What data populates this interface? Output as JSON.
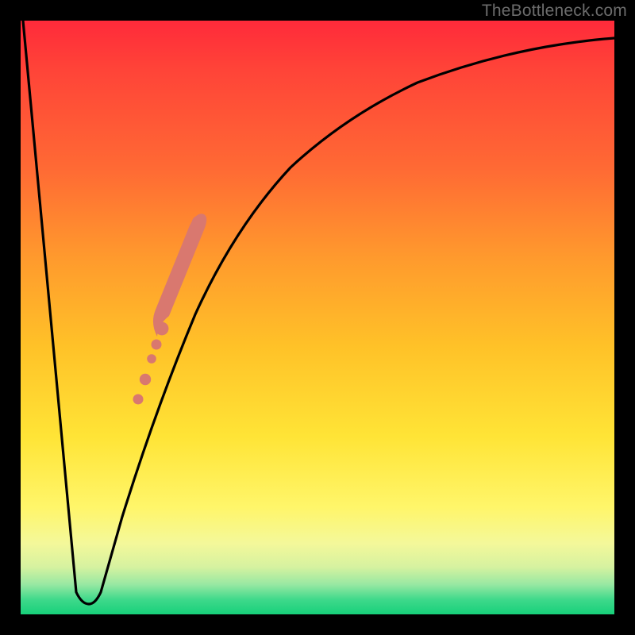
{
  "watermark": "TheBottleneck.com",
  "colors": {
    "background": "#000000",
    "gradient_top": "#ff2a3a",
    "gradient_bottom": "#17d07a",
    "curve": "#000000",
    "marker": "#d9786f"
  },
  "chart_data": {
    "type": "line",
    "title": "",
    "xlabel": "",
    "ylabel": "",
    "xlim": [
      0,
      100
    ],
    "ylim": [
      0,
      100
    ],
    "grid": false,
    "legend": false,
    "series": [
      {
        "name": "bottleneck-curve",
        "x": [
          0,
          2,
          4,
          6,
          8,
          10,
          11,
          12,
          14,
          16,
          18,
          20,
          22,
          25,
          28,
          32,
          36,
          40,
          45,
          50,
          55,
          60,
          65,
          70,
          75,
          80,
          85,
          90,
          95,
          100
        ],
        "y": [
          100,
          80,
          60,
          40,
          20,
          5,
          2,
          2,
          8,
          18,
          28,
          37,
          45,
          54,
          62,
          69,
          75,
          79,
          83,
          86,
          88.5,
          90.5,
          92,
          93.2,
          94.2,
          95,
          95.6,
          96.1,
          96.5,
          96.8
        ]
      }
    ],
    "markers": [
      {
        "name": "dot-1",
        "x": 19.5,
        "y": 36.5,
        "r": 1.7
      },
      {
        "name": "dot-2",
        "x": 20.7,
        "y": 40.0,
        "r": 1.9
      },
      {
        "name": "dot-3",
        "x": 21.8,
        "y": 43.5,
        "r": 1.5
      },
      {
        "name": "dot-4",
        "x": 22.6,
        "y": 46.0,
        "r": 1.7
      },
      {
        "name": "blob-start",
        "x": 23.4,
        "y": 48.5,
        "r": 2.2
      },
      {
        "name": "blob-mid1",
        "x": 25.0,
        "y": 53.0,
        "r": 2.3
      },
      {
        "name": "blob-mid2",
        "x": 26.8,
        "y": 58.0,
        "r": 2.3
      },
      {
        "name": "blob-mid3",
        "x": 28.5,
        "y": 62.5,
        "r": 2.3
      },
      {
        "name": "blob-end",
        "x": 30.2,
        "y": 66.5,
        "r": 2.2
      }
    ]
  }
}
